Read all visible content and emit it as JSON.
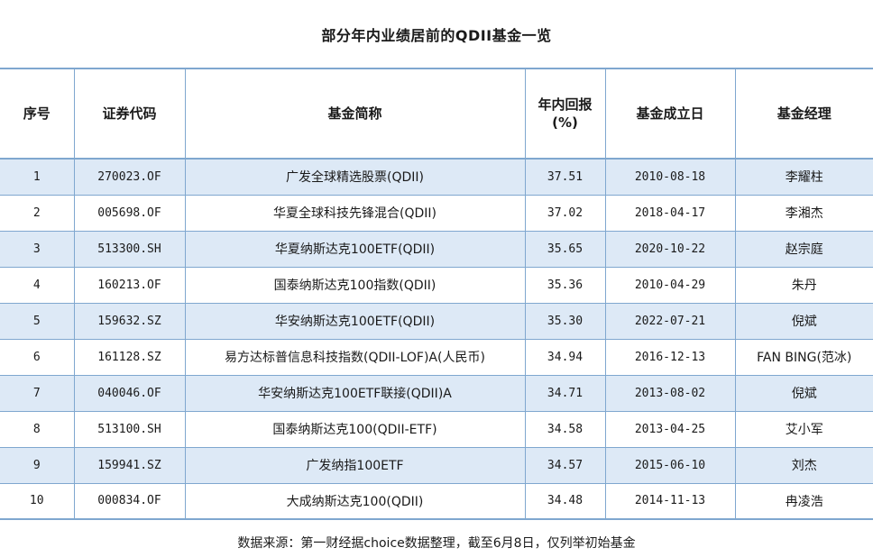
{
  "title": "部分年内业绩居前的QDII基金一览",
  "columns": {
    "index": "序号",
    "code": "证券代码",
    "name": "基金简称",
    "return_line1": "年内回报",
    "return_line2": "(%)",
    "inception": "基金成立日",
    "manager": "基金经理"
  },
  "rows": [
    {
      "index": "1",
      "code": "270023.OF",
      "name": "广发全球精选股票(QDII)",
      "return": "37.51",
      "inception": "2010-08-18",
      "manager": "李耀柱"
    },
    {
      "index": "2",
      "code": "005698.OF",
      "name": "华夏全球科技先锋混合(QDII)",
      "return": "37.02",
      "inception": "2018-04-17",
      "manager": "李湘杰"
    },
    {
      "index": "3",
      "code": "513300.SH",
      "name": "华夏纳斯达克100ETF(QDII)",
      "return": "35.65",
      "inception": "2020-10-22",
      "manager": "赵宗庭"
    },
    {
      "index": "4",
      "code": "160213.OF",
      "name": "国泰纳斯达克100指数(QDII)",
      "return": "35.36",
      "inception": "2010-04-29",
      "manager": "朱丹"
    },
    {
      "index": "5",
      "code": "159632.SZ",
      "name": "华安纳斯达克100ETF(QDII)",
      "return": "35.30",
      "inception": "2022-07-21",
      "manager": "倪斌"
    },
    {
      "index": "6",
      "code": "161128.SZ",
      "name": "易方达标普信息科技指数(QDII-LOF)A(人民币)",
      "return": "34.94",
      "inception": "2016-12-13",
      "manager": "FAN BING(范冰)"
    },
    {
      "index": "7",
      "code": "040046.OF",
      "name": "华安纳斯达克100ETF联接(QDII)A",
      "return": "34.71",
      "inception": "2013-08-02",
      "manager": "倪斌"
    },
    {
      "index": "8",
      "code": "513100.SH",
      "name": "国泰纳斯达克100(QDII-ETF)",
      "return": "34.58",
      "inception": "2013-04-25",
      "manager": "艾小军"
    },
    {
      "index": "9",
      "code": "159941.SZ",
      "name": "广发纳指100ETF",
      "return": "34.57",
      "inception": "2015-06-10",
      "manager": "刘杰"
    },
    {
      "index": "10",
      "code": "000834.OF",
      "name": "大成纳斯达克100(QDII)",
      "return": "34.48",
      "inception": "2014-11-13",
      "manager": "冉凌浩"
    }
  ],
  "footer": "数据来源：第一财经据choice数据整理，截至6月8日，仅列举初始基金",
  "colors": {
    "border": "#7fa7cf",
    "stripe": "#dde9f6"
  }
}
